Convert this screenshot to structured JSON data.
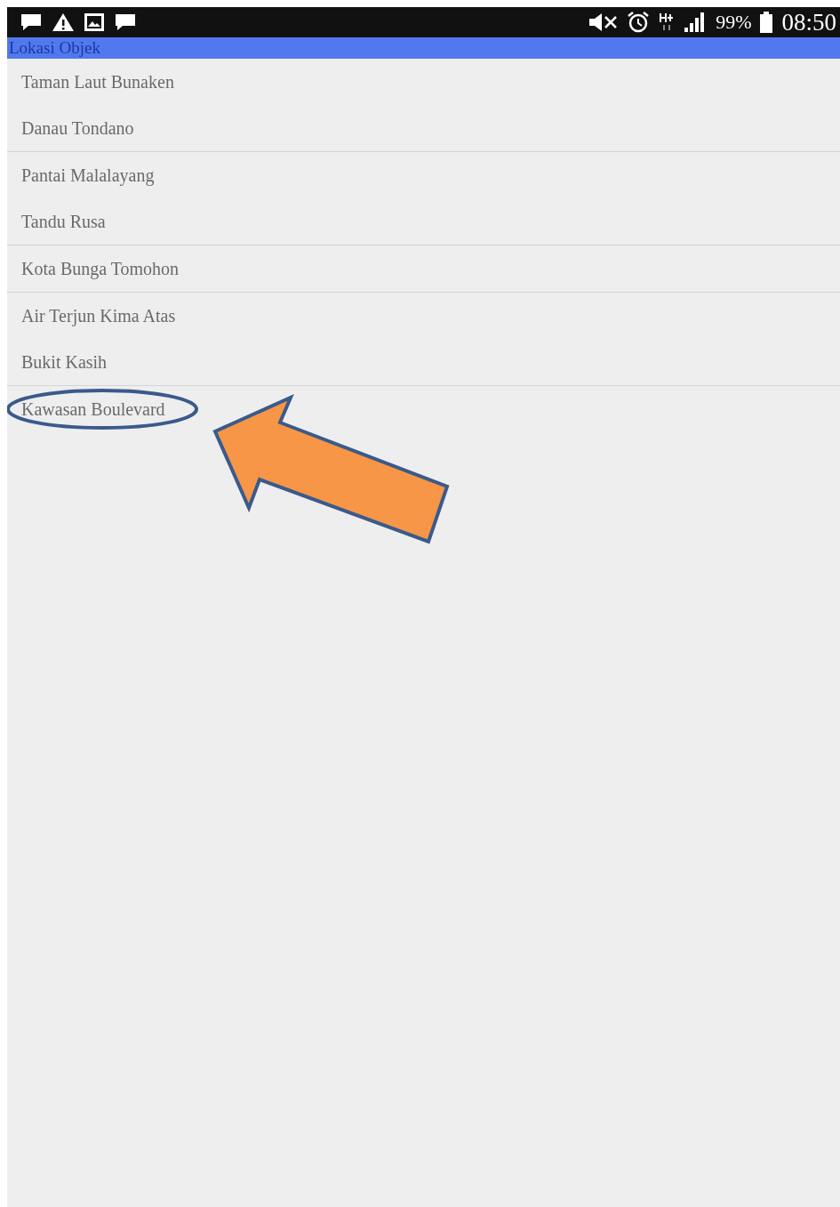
{
  "status_bar": {
    "battery": "99%",
    "time": "08:50"
  },
  "title_bar": {
    "title": "Lokasi Objek"
  },
  "groups": [
    {
      "items": [
        "Taman Laut Bunaken",
        "Danau Tondano"
      ],
      "highlighted": false
    },
    {
      "items": [
        "Pantai Malalayang",
        "Tandu Rusa"
      ],
      "highlighted": false
    },
    {
      "items": [
        "Kota Bunga Tomohon"
      ],
      "highlighted": false
    },
    {
      "items": [
        "Air Terjun Kima Atas",
        "Bukit Kasih"
      ],
      "highlighted": false
    },
    {
      "items": [
        "Kawasan Boulevard"
      ],
      "highlighted": true
    }
  ]
}
